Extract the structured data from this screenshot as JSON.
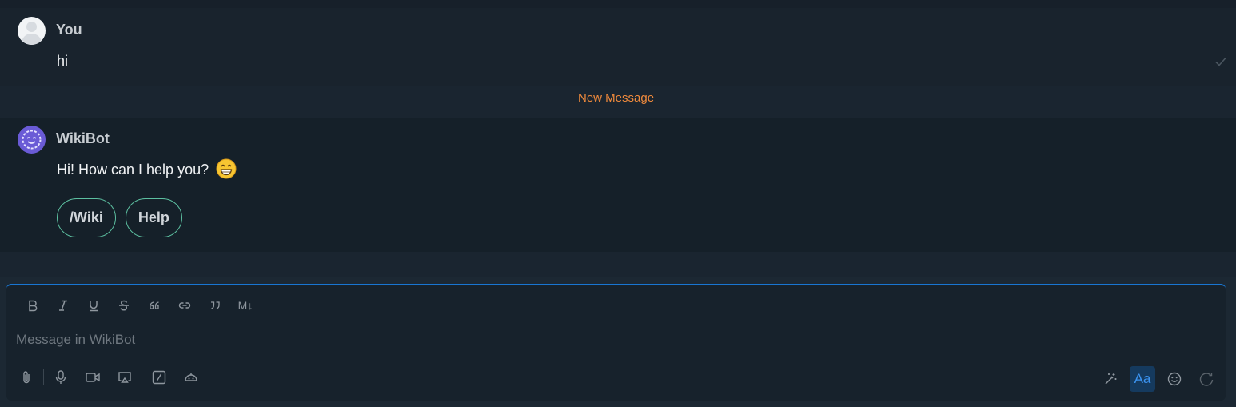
{
  "conversation": {
    "user_message": {
      "sender": "You",
      "text": "hi"
    },
    "divider_label": "New Message",
    "bot_message": {
      "sender": "WikiBot",
      "text": "Hi! How can I help you?",
      "emoji_name": "grinning-face-emoji",
      "actions": [
        "/Wiki",
        "Help"
      ]
    }
  },
  "composer": {
    "placeholder": "Message in WikiBot",
    "value": "",
    "format_tools": [
      "bold",
      "italic",
      "underline",
      "strikethrough",
      "quote",
      "link",
      "blockquote",
      "markdown"
    ],
    "markdown_label": "M↓",
    "format_toggle_label": "Aa"
  },
  "colors": {
    "accent_blue": "#1976d2",
    "new_message_orange": "#f08a3c",
    "action_border": "#5cbfa0",
    "bot_avatar": "#6a5bd6"
  }
}
